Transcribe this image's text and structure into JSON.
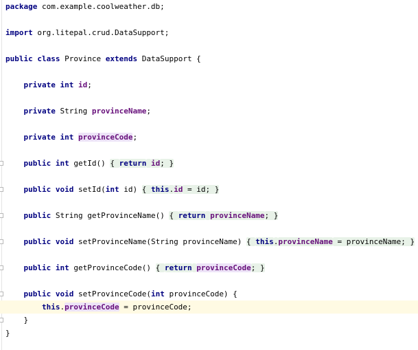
{
  "editor": {
    "language": "java",
    "file_lines": [
      {
        "tokens": [
          {
            "t": "package",
            "c": "kw"
          },
          {
            "t": " com.example.coolweather.db;"
          }
        ]
      },
      {
        "tokens": []
      },
      {
        "tokens": [
          {
            "t": "import",
            "c": "kw"
          },
          {
            "t": " org.litepal.crud.DataSupport;"
          }
        ]
      },
      {
        "tokens": []
      },
      {
        "tokens": [
          {
            "t": "public",
            "c": "kw"
          },
          {
            "t": " "
          },
          {
            "t": "class",
            "c": "kw"
          },
          {
            "t": " Province "
          },
          {
            "t": "extends",
            "c": "kw"
          },
          {
            "t": " DataSupport {"
          }
        ]
      },
      {
        "tokens": []
      },
      {
        "tokens": [
          {
            "t": "    "
          },
          {
            "t": "private",
            "c": "kw"
          },
          {
            "t": " "
          },
          {
            "t": "int",
            "c": "kw"
          },
          {
            "t": " "
          },
          {
            "t": "id",
            "c": "fld"
          },
          {
            "t": ";"
          }
        ]
      },
      {
        "tokens": []
      },
      {
        "tokens": [
          {
            "t": "    "
          },
          {
            "t": "private",
            "c": "kw"
          },
          {
            "t": " String "
          },
          {
            "t": "provinceName",
            "c": "fld"
          },
          {
            "t": ";"
          }
        ]
      },
      {
        "tokens": []
      },
      {
        "tokens": [
          {
            "t": "    "
          },
          {
            "t": "private",
            "c": "kw"
          },
          {
            "t": " "
          },
          {
            "t": "int",
            "c": "kw"
          },
          {
            "t": " "
          },
          {
            "t": "provinceCode",
            "c": "fld hl"
          },
          {
            "t": ";"
          }
        ]
      },
      {
        "tokens": []
      },
      {
        "fold": true,
        "tokens": [
          {
            "t": "    "
          },
          {
            "t": "public",
            "c": "kw"
          },
          {
            "t": " "
          },
          {
            "t": "int",
            "c": "kw"
          },
          {
            "t": " getId() "
          },
          {
            "t": "{ ",
            "c": "brace"
          },
          {
            "t": "return",
            "c": "kw brace"
          },
          {
            "t": " ",
            "c": "brace"
          },
          {
            "t": "id",
            "c": "fld brace"
          },
          {
            "t": "; }",
            "c": "brace"
          }
        ]
      },
      {
        "tokens": []
      },
      {
        "fold": true,
        "tokens": [
          {
            "t": "    "
          },
          {
            "t": "public",
            "c": "kw"
          },
          {
            "t": " "
          },
          {
            "t": "void",
            "c": "kw"
          },
          {
            "t": " setId("
          },
          {
            "t": "int",
            "c": "kw"
          },
          {
            "t": " id) "
          },
          {
            "t": "{ ",
            "c": "brace"
          },
          {
            "t": "this",
            "c": "kw brace"
          },
          {
            "t": ".",
            "c": "brace"
          },
          {
            "t": "id",
            "c": "fld brace"
          },
          {
            "t": " = id; }",
            "c": "brace"
          }
        ]
      },
      {
        "tokens": []
      },
      {
        "fold": true,
        "tokens": [
          {
            "t": "    "
          },
          {
            "t": "public",
            "c": "kw"
          },
          {
            "t": " String getProvinceName() "
          },
          {
            "t": "{ ",
            "c": "brace"
          },
          {
            "t": "return",
            "c": "kw brace"
          },
          {
            "t": " ",
            "c": "brace"
          },
          {
            "t": "provinceName",
            "c": "fld brace"
          },
          {
            "t": "; }",
            "c": "brace"
          }
        ]
      },
      {
        "tokens": []
      },
      {
        "fold": true,
        "tokens": [
          {
            "t": "    "
          },
          {
            "t": "public",
            "c": "kw"
          },
          {
            "t": " "
          },
          {
            "t": "void",
            "c": "kw"
          },
          {
            "t": " setProvinceName(String provinceName) "
          },
          {
            "t": "{ ",
            "c": "brace"
          },
          {
            "t": "this",
            "c": "kw brace"
          },
          {
            "t": ".",
            "c": "brace"
          },
          {
            "t": "provinceName",
            "c": "fld brace"
          },
          {
            "t": " = provinceName; }",
            "c": "brace"
          }
        ]
      },
      {
        "tokens": []
      },
      {
        "fold": true,
        "tokens": [
          {
            "t": "    "
          },
          {
            "t": "public",
            "c": "kw"
          },
          {
            "t": " "
          },
          {
            "t": "int",
            "c": "kw"
          },
          {
            "t": " getProvinceCode() "
          },
          {
            "t": "{ ",
            "c": "brace"
          },
          {
            "t": "return",
            "c": "kw brace"
          },
          {
            "t": " ",
            "c": "brace"
          },
          {
            "t": "provinceCode",
            "c": "fld hl"
          },
          {
            "t": "; }",
            "c": "brace"
          }
        ]
      },
      {
        "tokens": []
      },
      {
        "fold": true,
        "tokens": [
          {
            "t": "    "
          },
          {
            "t": "public",
            "c": "kw"
          },
          {
            "t": " "
          },
          {
            "t": "void",
            "c": "kw"
          },
          {
            "t": " setProvinceCode("
          },
          {
            "t": "int",
            "c": "kw"
          },
          {
            "t": " provinceCode) {"
          }
        ]
      },
      {
        "current": true,
        "tokens": [
          {
            "t": "        "
          },
          {
            "t": "this",
            "c": "kw"
          },
          {
            "t": "."
          },
          {
            "t": "provinceCode",
            "c": "fld hl"
          },
          {
            "t": " = provinceCode;"
          }
        ]
      },
      {
        "fold": true,
        "tokens": [
          {
            "t": "    }"
          }
        ]
      },
      {
        "tokens": [
          {
            "t": "}"
          }
        ]
      }
    ]
  },
  "colors": {
    "keyword": "#000080",
    "field": "#660e7a",
    "current_line": "#fffae3",
    "usage_highlight": "#ede3f7",
    "folded_brace": "#e8f2e8"
  },
  "icons": {
    "fold_marker": "fold-marker-icon"
  }
}
